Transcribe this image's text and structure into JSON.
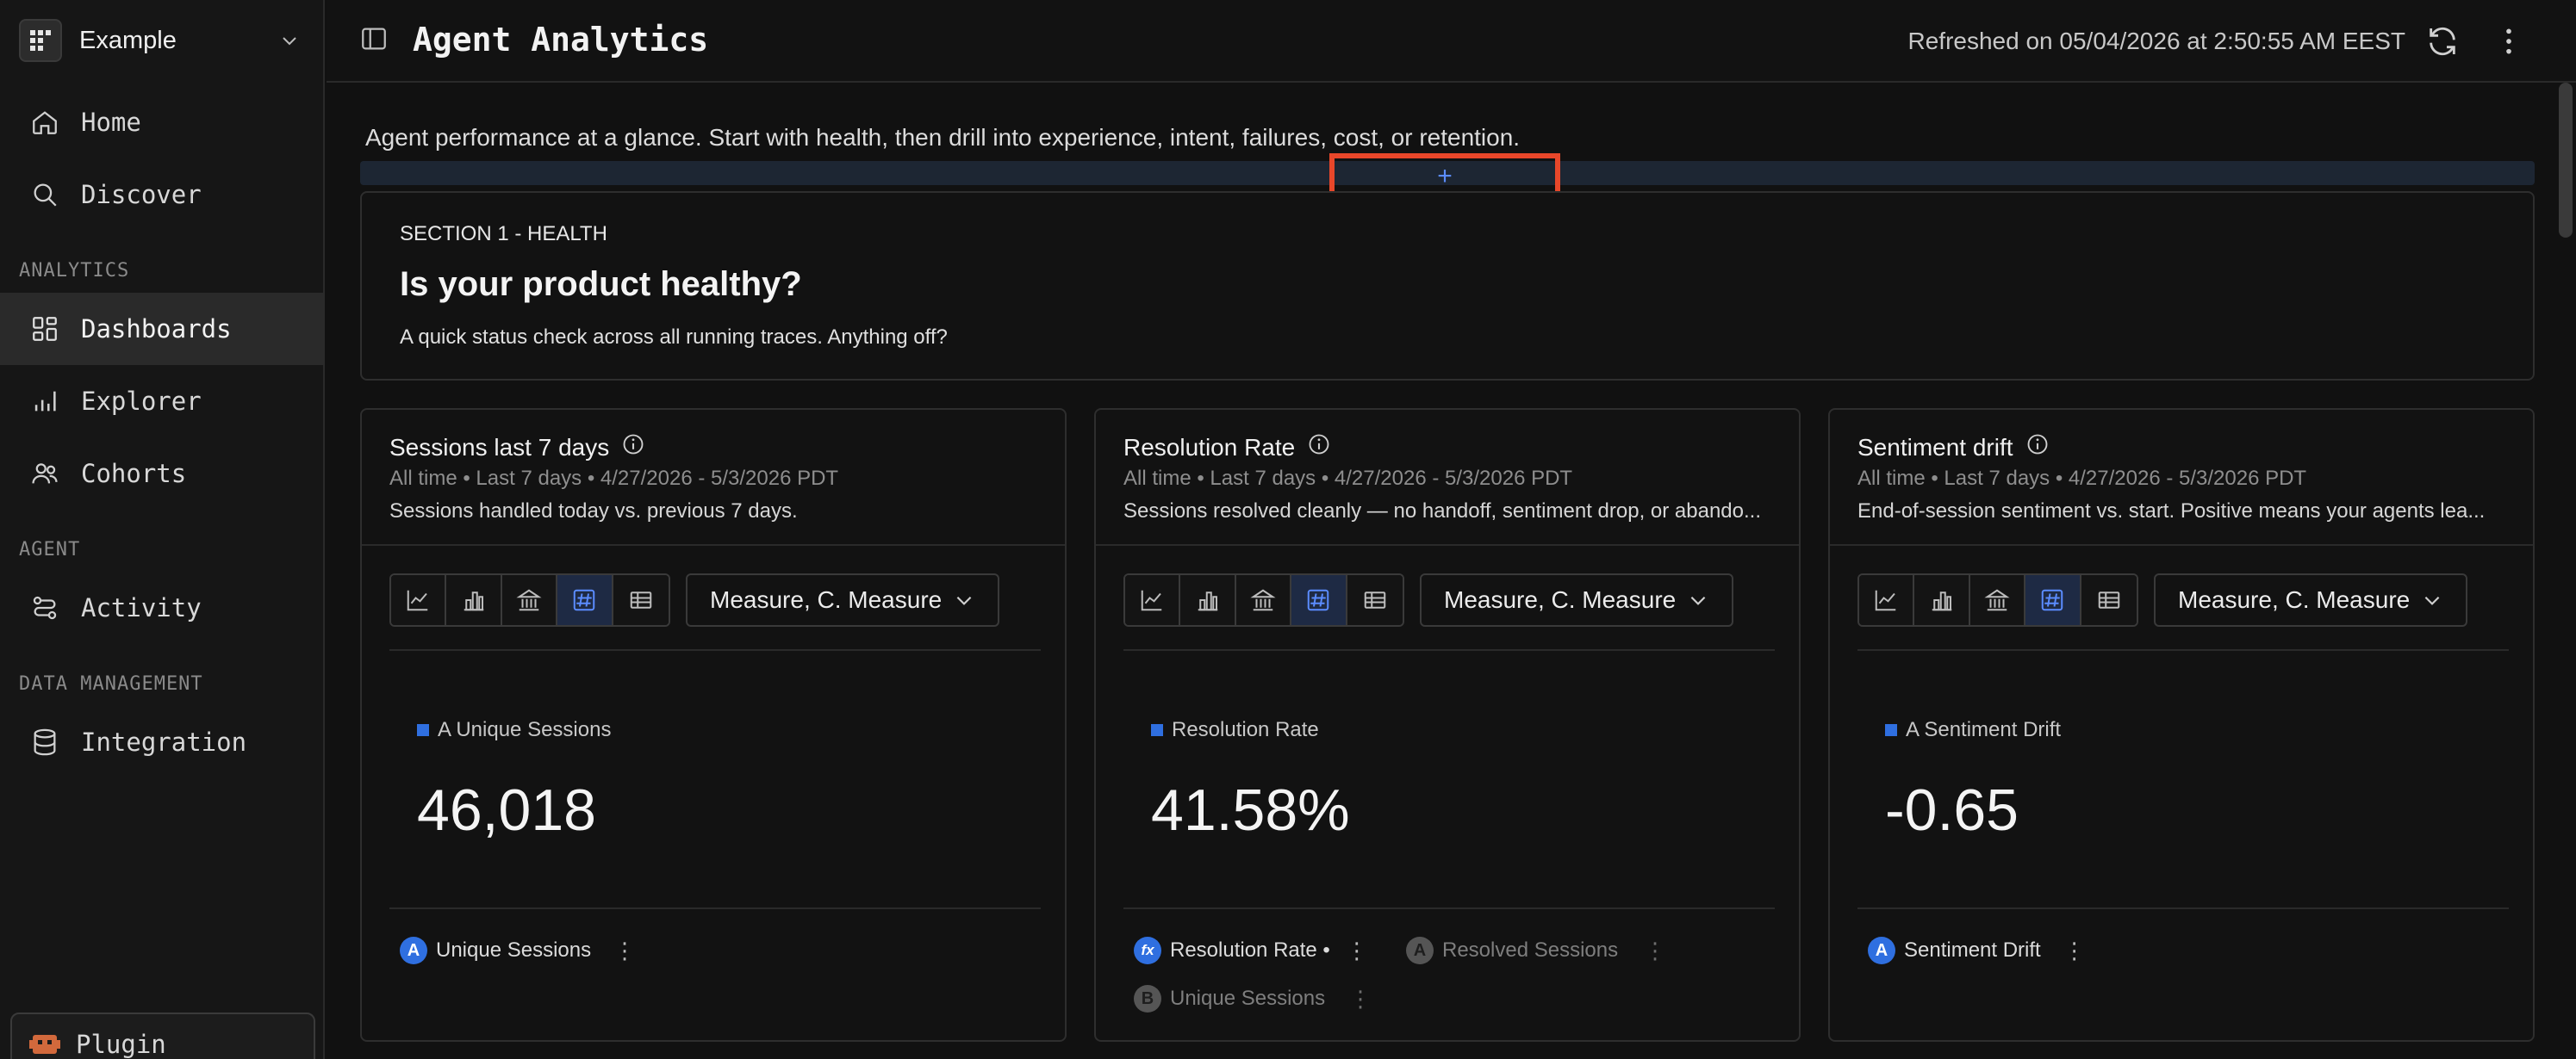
{
  "workspace": {
    "name": "Example"
  },
  "sidebar": {
    "items_top": [
      {
        "label": "Home",
        "icon": "home-icon"
      },
      {
        "label": "Discover",
        "icon": "search-icon"
      }
    ],
    "sections": [
      {
        "title": "ANALYTICS",
        "items": [
          {
            "label": "Dashboards",
            "icon": "dashboard-icon",
            "active": true
          },
          {
            "label": "Explorer",
            "icon": "bar-chart-icon"
          },
          {
            "label": "Cohorts",
            "icon": "users-icon"
          }
        ]
      },
      {
        "title": "AGENT",
        "items": [
          {
            "label": "Activity",
            "icon": "activity-icon"
          }
        ]
      },
      {
        "title": "DATA MANAGEMENT",
        "items": [
          {
            "label": "Integration",
            "icon": "database-icon"
          }
        ]
      }
    ],
    "plugin_label": "Plugin"
  },
  "header": {
    "title": "Agent Analytics",
    "refreshed": "Refreshed on 05/04/2026 at 2:50:55 AM EEST"
  },
  "main": {
    "intro": "Agent performance at a glance. Start with health, then drill into experience, intent, failures, cost, or retention.",
    "add_symbol": "+",
    "section": {
      "eyebrow": "SECTION 1 - HEALTH",
      "title": "Is your product healthy?",
      "subtitle": "A quick status check across all running traces. Anything off?"
    },
    "cards": [
      {
        "title": "Sessions last 7 days",
        "meta": "All time • Last 7 days • 4/27/2026 - 5/3/2026 PDT",
        "desc": "Sessions handled today vs. previous 7 days.",
        "measure": "Measure, C. Measure",
        "legend": "A Unique Sessions",
        "value": "46,018",
        "pills": [
          {
            "badge": "A",
            "label": "Unique Sessions",
            "dim": false
          }
        ]
      },
      {
        "title": "Resolution Rate",
        "meta": "All time • Last 7 days • 4/27/2026 - 5/3/2026 PDT",
        "desc": "Sessions resolved cleanly — no handoff, sentiment drop, or abando...",
        "measure": "Measure, C. Measure",
        "legend": "Resolution Rate",
        "value": "41.58%",
        "pills": [
          {
            "badge": "fx",
            "label": "Resolution Rate •",
            "dim": false
          },
          {
            "badge": "A",
            "label": "Resolved Sessions",
            "dim": true
          },
          {
            "badge": "B",
            "label": "Unique Sessions",
            "dim": true
          }
        ]
      },
      {
        "title": "Sentiment drift",
        "meta": "All time • Last 7 days • 4/27/2026 - 5/3/2026 PDT",
        "desc": "End-of-session sentiment vs. start. Positive means your agents lea...",
        "measure": "Measure, C. Measure",
        "legend": "A Sentiment Drift",
        "value": "-0.65",
        "pills": [
          {
            "badge": "A",
            "label": "Sentiment Drift",
            "dim": false
          }
        ]
      }
    ]
  },
  "colors": {
    "accent": "#2f6fe0",
    "highlight": "#e8472a",
    "background": "#111111"
  }
}
